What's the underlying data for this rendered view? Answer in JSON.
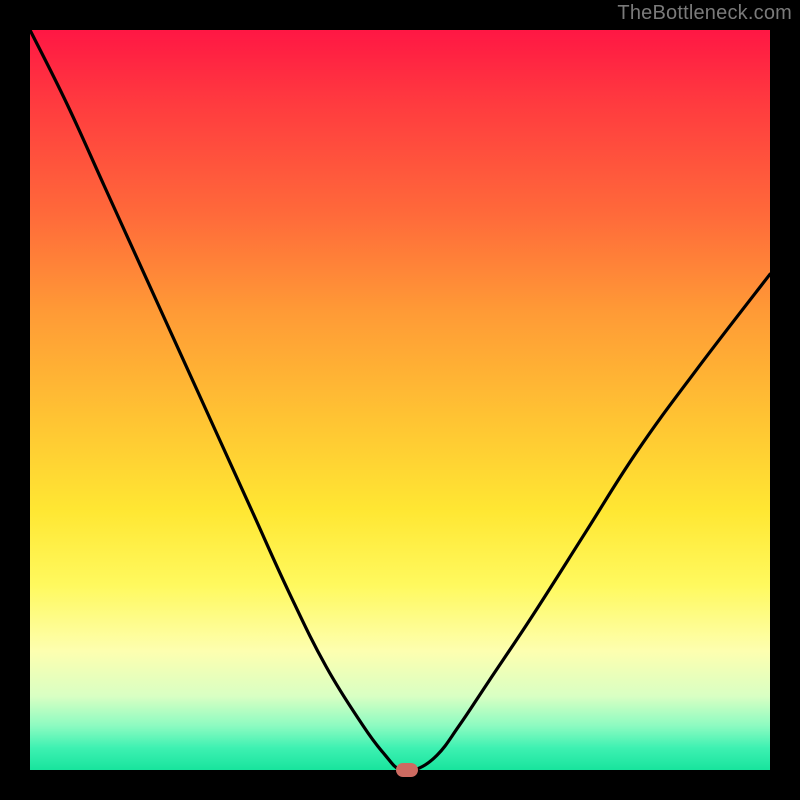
{
  "watermark": "TheBottleneck.com",
  "chart_data": {
    "type": "line",
    "title": "",
    "xlabel": "",
    "ylabel": "",
    "xlim": [
      0,
      100
    ],
    "ylim": [
      0,
      100
    ],
    "grid": false,
    "legend": false,
    "series": [
      {
        "name": "bottleneck-curve",
        "x": [
          0,
          5,
          10,
          15,
          20,
          25,
          30,
          35,
          40,
          45,
          48,
          50,
          52,
          55,
          58,
          62,
          68,
          75,
          82,
          90,
          100
        ],
        "values": [
          100,
          90,
          79,
          68,
          57,
          46,
          35,
          24,
          14,
          6,
          2,
          0,
          0,
          2,
          6,
          12,
          21,
          32,
          43,
          54,
          67
        ]
      }
    ],
    "minimum_point": {
      "x": 51,
      "y": 0
    },
    "gradient_stops": [
      {
        "pct": 0,
        "color": "#ff1744"
      },
      {
        "pct": 25,
        "color": "#ff6a3a"
      },
      {
        "pct": 52,
        "color": "#ffc233"
      },
      {
        "pct": 75,
        "color": "#fff95e"
      },
      {
        "pct": 94,
        "color": "#8dfbc1"
      },
      {
        "pct": 100,
        "color": "#18e49d"
      }
    ]
  }
}
